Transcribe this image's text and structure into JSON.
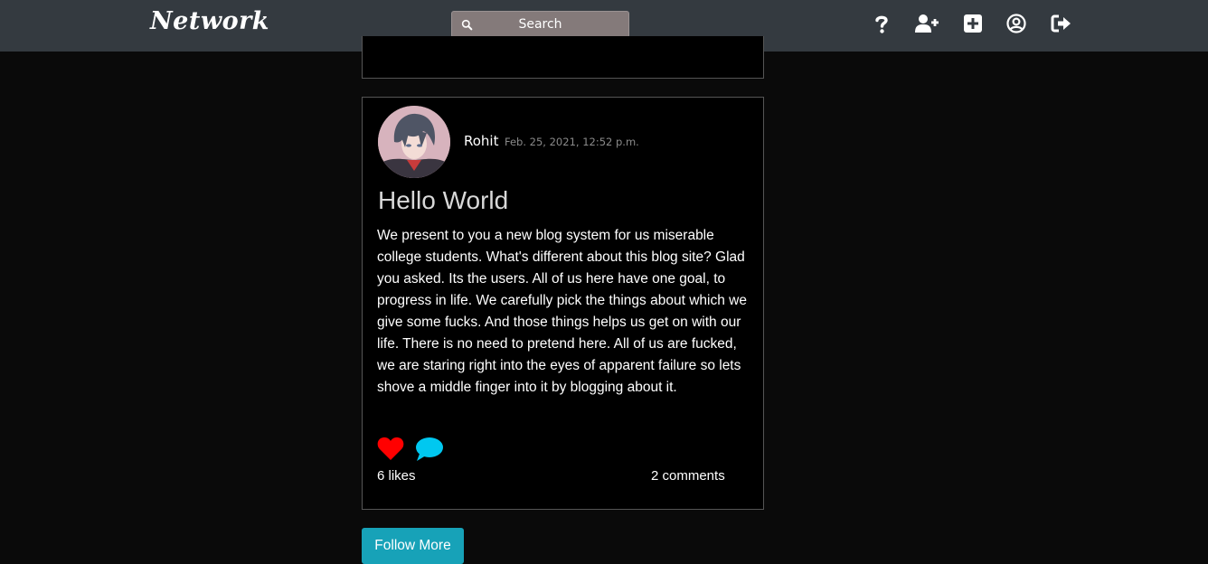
{
  "navbar": {
    "brand": "Network",
    "search_label": "Search",
    "icons": [
      "question-icon",
      "add-user-icon",
      "new-post-icon",
      "profile-icon",
      "logout-icon"
    ]
  },
  "post": {
    "username": "Rohit",
    "timestamp": "Feb. 25, 2021, 12:52 p.m.",
    "title": "Hello World",
    "body": "We present to you a new blog system for us miserable college students. What's different about this blog site? Glad you asked. Its the users. All of us here have one goal, to progress in life. We carefully pick the things about which we give some fucks. And those things helps us get on with our life. There is no need to pretend here. All of us are fucked, we are staring right into the eyes of apparent failure so lets shove a middle finger into it by blogging about it.",
    "likes": "6 likes",
    "comments": "2 comments",
    "heart_color": "#ff0000",
    "comment_color": "#00c8f0"
  },
  "follow_button": "Follow More"
}
